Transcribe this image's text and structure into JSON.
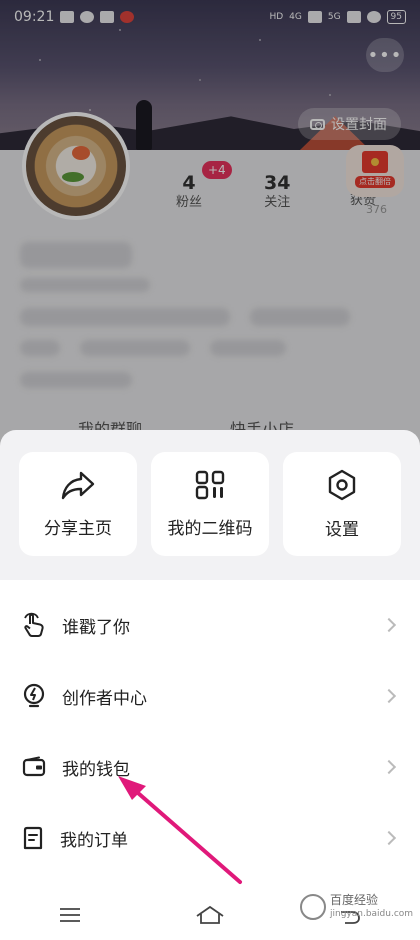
{
  "status_bar": {
    "time": "09:21",
    "network_1": "HD",
    "network_2": "4G",
    "network_3": "5G",
    "battery": "95"
  },
  "cover": {
    "set_cover_label": "设置封面",
    "more_label": "•••"
  },
  "profile": {
    "fans_count": "4",
    "fans_label": "粉丝",
    "fans_badge": "+4",
    "following_count": "34",
    "following_label": "关注",
    "likes_label": "获赞",
    "likes_count_sub": "376",
    "red_packet_label": "点击翻倍",
    "group_chat_label": "我的群聊",
    "shop_label": "快手小店"
  },
  "sheet": {
    "actions": [
      {
        "label": "分享主页",
        "icon": "share-icon"
      },
      {
        "label": "我的二维码",
        "icon": "qrcode-icon"
      },
      {
        "label": "设置",
        "icon": "settings-hexagon-icon"
      }
    ],
    "menu": [
      {
        "label": "谁戳了你",
        "icon": "poke-hand-icon"
      },
      {
        "label": "创作者中心",
        "icon": "lightbulb-icon"
      },
      {
        "label": "我的钱包",
        "icon": "wallet-icon"
      },
      {
        "label": "我的订单",
        "icon": "order-icon"
      }
    ]
  },
  "navbar": {
    "items": [
      "menu-icon",
      "home-icon",
      "back-icon"
    ]
  },
  "watermark": {
    "text": "百度经验",
    "url": "jingyan.baidu.com"
  },
  "colors": {
    "accent_pink": "#e8325e",
    "arrow": "#e0197a",
    "sheet_bg": "#f2f2f4"
  }
}
